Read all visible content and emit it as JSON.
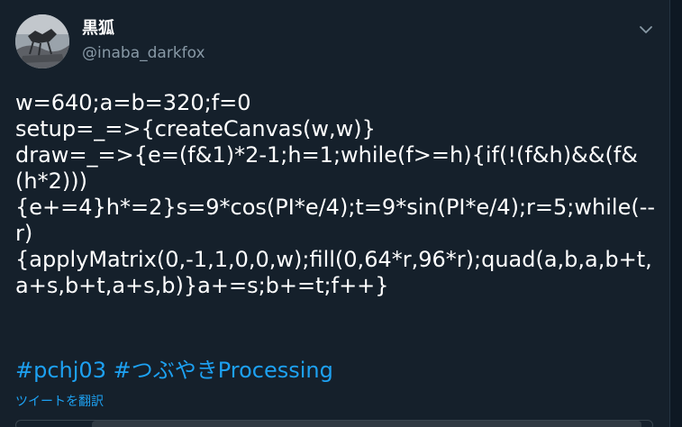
{
  "user": {
    "display_name": "黒狐",
    "handle": "@inaba_darkfox"
  },
  "icons": {
    "avatar": "avatar-photo",
    "menu": "chevron-down-icon"
  },
  "tweet": {
    "lines": [
      "w=640;a=b=320;f=0",
      "setup=_=>{createCanvas(w,w)}",
      "draw=_=>{e=(f&1)*2-1;h=1;while(f>=h){if(!(f&h)&&(f&",
      "(h*2)))",
      "{e+=4}h*=2}s=9*cos(PI*e/4);t=9*sin(PI*e/4);r=5;while(--",
      "r)",
      "{applyMatrix(0,-1,1,0,0,w);fill(0,64*r,96*r);quad(a,b,a,b+t,",
      "a+s,b+t,a+s,b)}a+=s;b+=t;f++}"
    ],
    "hashtags": [
      "#pchj03",
      "#つぶやきProcessing"
    ]
  },
  "translate_label": "ツイートを翻訳",
  "colors": {
    "background": "#15202b",
    "text": "#ffffff",
    "secondary_text": "#8899a6",
    "link": "#1da1f2"
  }
}
